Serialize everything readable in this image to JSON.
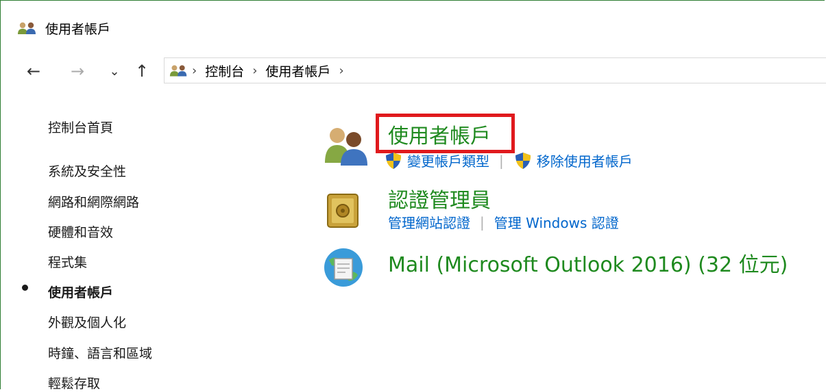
{
  "window": {
    "title": "使用者帳戶"
  },
  "nav": {
    "back_icon": "←",
    "forward_icon": "→",
    "recent_icon": "⌄",
    "up_icon": "↑",
    "breadcrumbs": [
      "控制台",
      "使用者帳戶"
    ],
    "sep": "›"
  },
  "sidebar": {
    "home": "控制台首頁",
    "items": [
      {
        "label": "系統及安全性"
      },
      {
        "label": "網路和網際網路"
      },
      {
        "label": "硬體和音效"
      },
      {
        "label": "程式集"
      },
      {
        "label": "使用者帳戶",
        "current": true
      },
      {
        "label": "外觀及個人化"
      },
      {
        "label": "時鐘、語言和區域"
      },
      {
        "label": "輕鬆存取"
      }
    ]
  },
  "categories": [
    {
      "title": "使用者帳戶",
      "icon": "users-icon",
      "links": [
        {
          "label": "變更帳戶類型",
          "shield": true
        },
        {
          "label": "移除使用者帳戶",
          "shield": true
        }
      ]
    },
    {
      "title": "認證管理員",
      "icon": "vault-icon",
      "links": [
        {
          "label": "管理網站認證"
        },
        {
          "label": "管理 Windows 認證"
        }
      ]
    },
    {
      "title": "Mail (Microsoft Outlook 2016) (32 位元)",
      "icon": "mail-icon",
      "links": []
    }
  ],
  "colors": {
    "category_title": "#1f8a1f",
    "link": "#0066cc",
    "highlight": "#e0191d",
    "frame": "#2e7d32"
  }
}
